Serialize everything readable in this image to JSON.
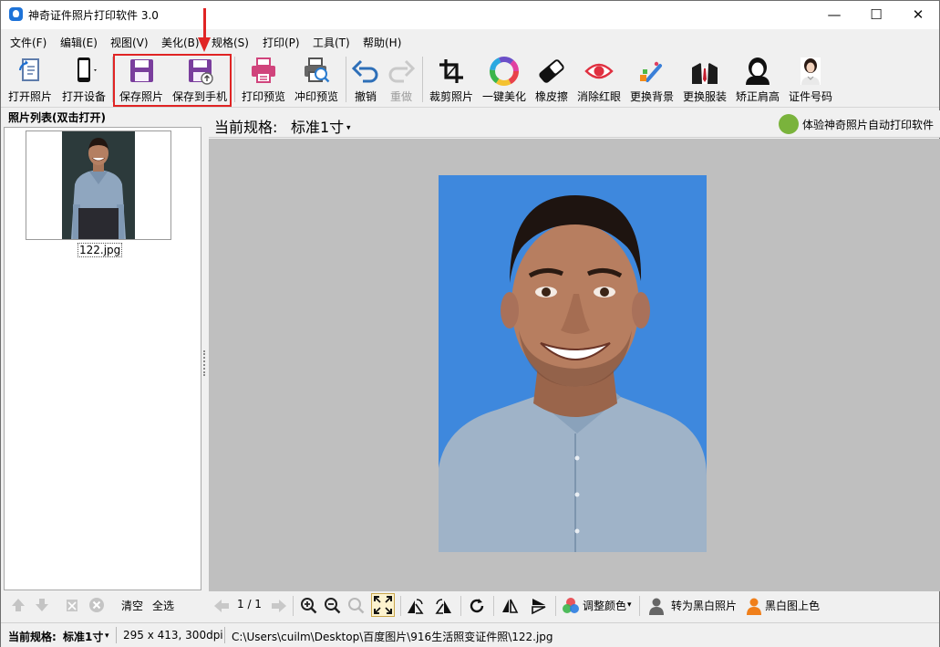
{
  "window": {
    "title": "神奇证件照片打印软件 3.0",
    "minimize": "—",
    "maximize": "☐",
    "close": "✕"
  },
  "menu": [
    "文件(F)",
    "编辑(E)",
    "视图(V)",
    "美化(B)",
    "规格(S)",
    "打印(P)",
    "工具(T)",
    "帮助(H)"
  ],
  "toolbar": {
    "open_photo": "打开照片",
    "open_device": "打开设备",
    "save_photo": "保存照片",
    "save_to_phone": "保存到手机",
    "print_preview": "打印预览",
    "develop_preview": "冲印预览",
    "undo": "撤销",
    "redo": "重做",
    "crop": "裁剪照片",
    "beautify": "一键美化",
    "eraser": "橡皮擦",
    "red_eye": "消除红眼",
    "change_bg": "更换背景",
    "change_clothes": "更换服装",
    "fix_shoulder": "矫正肩高",
    "id_size": "证件号码"
  },
  "left_panel": {
    "header": "照片列表(双击打开)",
    "thumb_name": "122.jpg",
    "clear": "清空",
    "select_all": "全选"
  },
  "spec_bar": {
    "label": "当前规格:",
    "value": "标准1寸",
    "promo": "体验神奇照片自动打印软件"
  },
  "bottom_bar": {
    "page": "1 / 1",
    "adjust_color": "调整颜色",
    "to_bw": "转为黑白照片",
    "bw_colorize": "黑白图上色"
  },
  "status": {
    "spec_label": "当前规格:",
    "spec_value": "标准1寸",
    "dims": "295 x 413, 300dpi",
    "path": "C:\\Users\\cuilm\\Desktop\\百度图片\\916生活照变证件照\\122.jpg"
  },
  "colors": {
    "photo_bg": "#3e88dd",
    "highlight": "#e02424",
    "save_icon": "#7a3e9d"
  }
}
